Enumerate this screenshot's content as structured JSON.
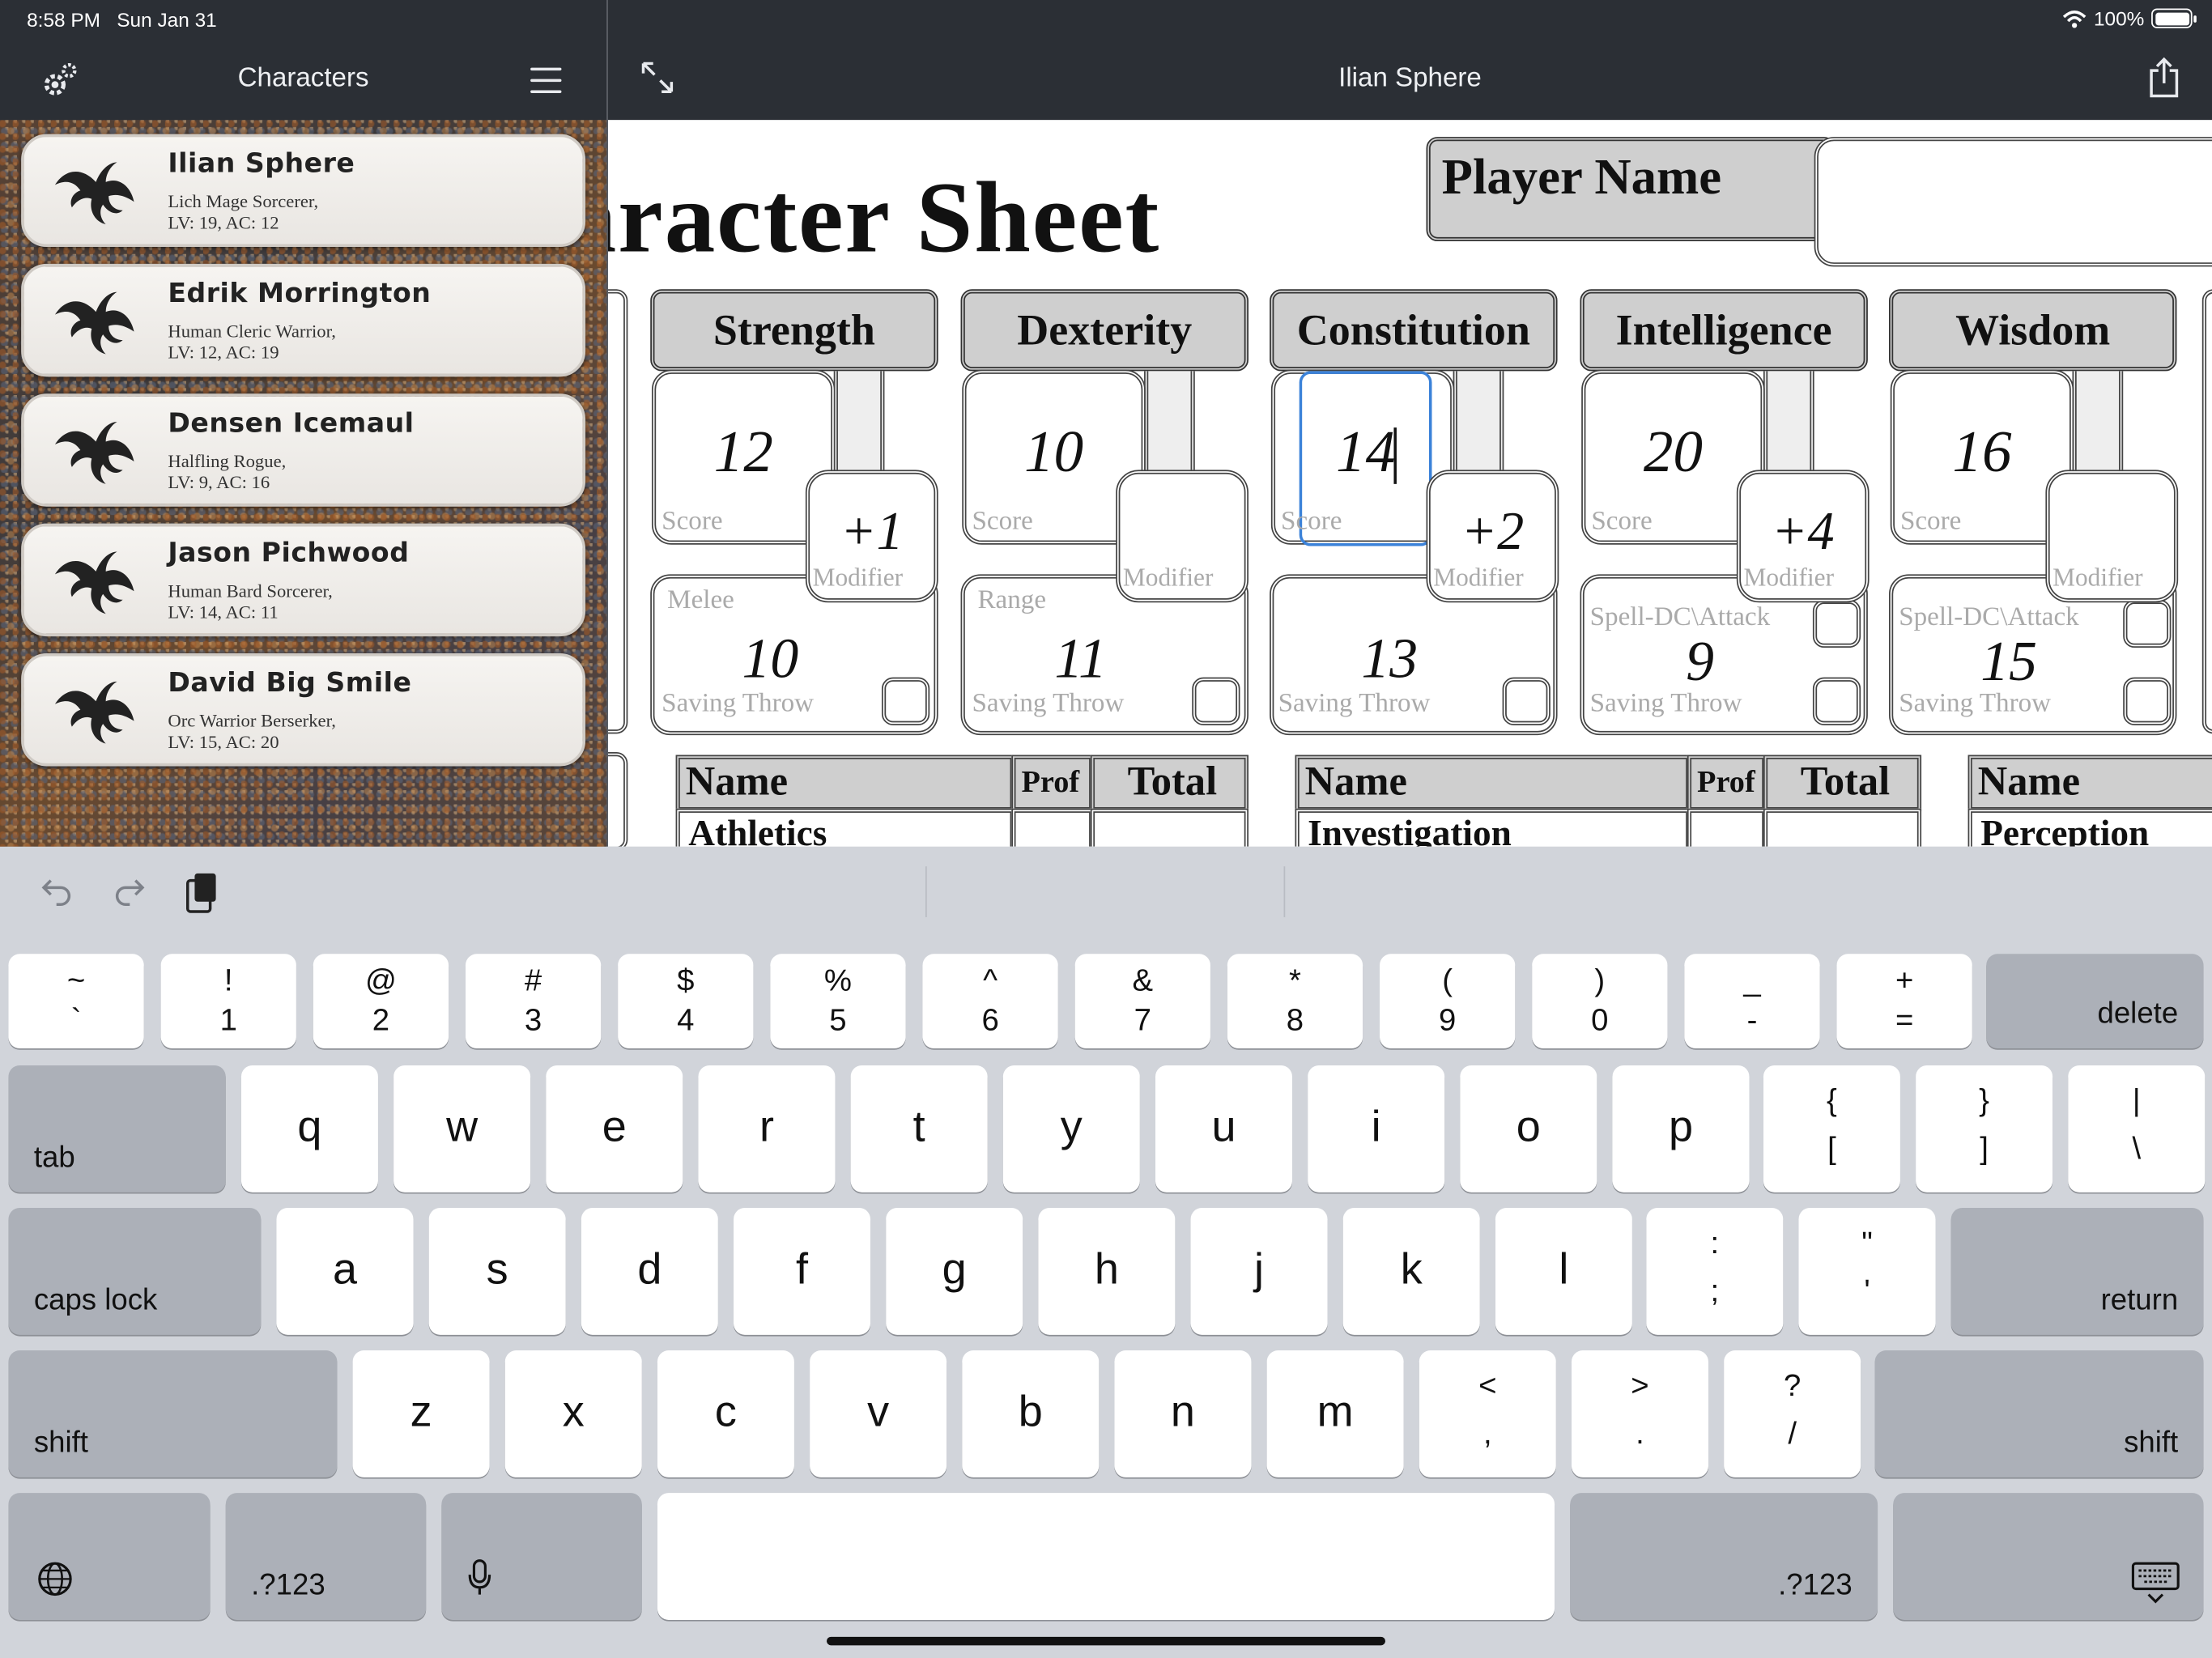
{
  "status": {
    "time": "8:58 PM",
    "date": "Sun Jan 31",
    "battery": "100%"
  },
  "sidebar": {
    "title": "Characters",
    "characters": [
      {
        "name": "Ilian Sphere",
        "line1": "Lich Mage Sorcerer,",
        "line2": "LV: 19, AC: 12"
      },
      {
        "name": "Edrik Morrington",
        "line1": "Human Cleric Warrior,",
        "line2": "LV: 12, AC: 19"
      },
      {
        "name": "Densen Icemaul",
        "line1": "Halfling Rogue,",
        "line2": "LV: 9, AC: 16"
      },
      {
        "name": "Jason Pichwood",
        "line1": "Human Bard Sorcerer,",
        "line2": "LV: 14, AC: 11"
      },
      {
        "name": "David Big Smile",
        "line1": "Orc Warrior Berserker,",
        "line2": "LV: 15, AC: 20"
      }
    ]
  },
  "main": {
    "title": "Ilian Sphere"
  },
  "sheet": {
    "title": "aracter Sheet",
    "player_name_label": "Player Name",
    "player_name_value": "",
    "labels": {
      "score": "Score",
      "modifier": "Modifier",
      "saving_throw": "Saving Throw",
      "spell": "Spell-DC\\Attack"
    },
    "abilities": [
      {
        "name": "Strength",
        "score": "12",
        "modifier": "+1",
        "sub_label": "Melee",
        "save": "10"
      },
      {
        "name": "Dexterity",
        "score": "10",
        "modifier": "",
        "sub_label": "Range",
        "save": "11"
      },
      {
        "name": "Constitution",
        "score": "14",
        "modifier": "+2",
        "sub_label": "",
        "save": "13"
      },
      {
        "name": "Intelligence",
        "score": "20",
        "modifier": "+4",
        "sub_label": "Spell-DC\\Attack",
        "save": "9"
      },
      {
        "name": "Wisdom",
        "score": "16",
        "modifier": "",
        "sub_label": "Spell-DC\\Attack",
        "save": "15"
      }
    ],
    "skill_headers": {
      "name": "Name",
      "prof": "Prof",
      "total": "Total"
    },
    "skills_visible": [
      "Athletics",
      "Investigation",
      "Perception"
    ]
  },
  "keyboard": {
    "row1": [
      [
        "~",
        "`"
      ],
      [
        "!",
        "1"
      ],
      [
        "@",
        "2"
      ],
      [
        "#",
        "3"
      ],
      [
        "$",
        "4"
      ],
      [
        "%",
        "5"
      ],
      [
        "^",
        "6"
      ],
      [
        "&",
        "7"
      ],
      [
        "*",
        "8"
      ],
      [
        "(",
        "9"
      ],
      [
        ")",
        "0"
      ],
      [
        "_",
        "-"
      ],
      [
        "+",
        "="
      ]
    ],
    "delete": "delete",
    "tab": "tab",
    "row2": [
      "q",
      "w",
      "e",
      "r",
      "t",
      "y",
      "u",
      "i",
      "o",
      "p"
    ],
    "row2sym": [
      [
        "{",
        "["
      ],
      [
        "}",
        "]"
      ],
      [
        "|",
        "\\"
      ]
    ],
    "caps": "caps lock",
    "row3": [
      "a",
      "s",
      "d",
      "f",
      "g",
      "h",
      "j",
      "k",
      "l"
    ],
    "row3sym": [
      [
        ":",
        ";"
      ],
      [
        "\"",
        "'"
      ]
    ],
    "return": "return",
    "shift": "shift",
    "row4": [
      "z",
      "x",
      "c",
      "v",
      "b",
      "n",
      "m"
    ],
    "row4sym": [
      [
        "<",
        ","
      ],
      [
        ">",
        "."
      ],
      [
        "?",
        "/"
      ]
    ],
    "numkey": ".?123"
  }
}
